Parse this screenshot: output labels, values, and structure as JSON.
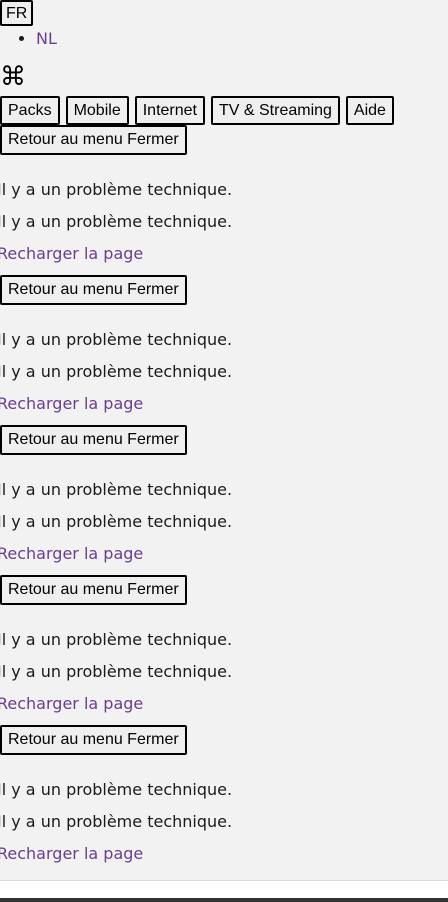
{
  "language": {
    "current": "FR",
    "options": [
      "NL"
    ]
  },
  "logo": {
    "glyph": "⌘",
    "icon": "command-icon"
  },
  "nav": {
    "items": [
      "Packs",
      "Mobile",
      "Internet",
      "TV & Streaming",
      "Aide"
    ]
  },
  "sections": [
    {
      "back_label": "Retour au menu Fermer",
      "error_1": "Il y a un problème technique.",
      "error_2": "Il y a un problème technique.",
      "reload_label": "Recharger la page"
    },
    {
      "back_label": "Retour au menu Fermer",
      "error_1": "Il y a un problème technique.",
      "error_2": "Il y a un problème technique.",
      "reload_label": "Recharger la page"
    },
    {
      "back_label": "Retour au menu Fermer",
      "error_1": "Il y a un problème technique.",
      "error_2": "Il y a un problème technique.",
      "reload_label": "Recharger la page"
    },
    {
      "back_label": "Retour au menu Fermer",
      "error_1": "Il y a un problème technique.",
      "error_2": "Il y a un problème technique.",
      "reload_label": "Recharger la page"
    },
    {
      "back_label": "Retour au menu Fermer",
      "error_1": "Il y a un problème technique.",
      "error_2": "Il y a un problème technique.",
      "reload_label": "Recharger la page"
    }
  ],
  "colors": {
    "background": "#f2f2f2",
    "link": "#6a3d8f",
    "text": "#1a1a1a"
  }
}
